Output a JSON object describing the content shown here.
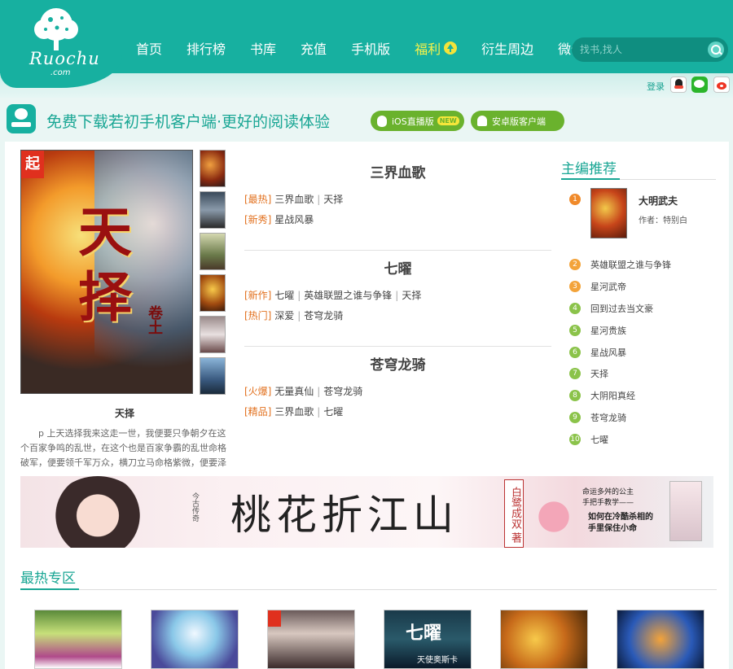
{
  "header": {
    "logo_text": "Ruochu",
    "logo_sub": ".com",
    "nav": [
      {
        "label": "首页"
      },
      {
        "label": "排行榜"
      },
      {
        "label": "书库"
      },
      {
        "label": "充值"
      },
      {
        "label": "手机版"
      },
      {
        "label": "福利"
      },
      {
        "label": "衍生周边"
      },
      {
        "label": "微信"
      }
    ],
    "search_placeholder": "找书,找人"
  },
  "subbar": {
    "login": "登录"
  },
  "promo": {
    "text": "免费下载若初手机客户端·更好的阅读体验",
    "ios_label": "iOS直播版",
    "ios_badge": "NEW",
    "android_label": "安卓版客户端"
  },
  "featured": {
    "cover_mark": "起",
    "cover_title": "天择",
    "cover_subtitle": "卷土",
    "caption": "天择",
    "description": "p 上天选择我来这走一世，我便要只争朝夕在这个百家争鸣的乱世，在这个也是百家争霸的乱世命格破军，便要领千军万众，横刀立马命格紫微，便要泽被苍生"
  },
  "blocks": [
    {
      "title": "三界血歌",
      "rows": [
        {
          "tag": "[最热]",
          "items": [
            "三界血歌",
            "天择"
          ]
        },
        {
          "tag": "[新秀]",
          "items": [
            "星战风暴"
          ]
        }
      ]
    },
    {
      "title": "七曜",
      "rows": [
        {
          "tag": "[新作]",
          "items": [
            "七曜",
            "英雄联盟之谁与争锋",
            "天择"
          ]
        },
        {
          "tag": "[热门]",
          "items": [
            "深爱",
            "苍穹龙骑"
          ]
        }
      ]
    },
    {
      "title": "苍穹龙骑",
      "rows": [
        {
          "tag": "[火爆]",
          "items": [
            "无量真仙",
            "苍穹龙骑"
          ]
        },
        {
          "tag": "[精品]",
          "items": [
            "三界血歌",
            "七曜"
          ]
        }
      ]
    }
  ],
  "recommend": {
    "title": "主编推荐",
    "top": {
      "rank": "1",
      "title": "大明武夫",
      "author": "作者：特别白"
    },
    "list": [
      {
        "rank": "2",
        "title": "英雄联盟之谁与争锋"
      },
      {
        "rank": "3",
        "title": "星河武帝"
      },
      {
        "rank": "4",
        "title": "回到过去当文豪"
      },
      {
        "rank": "5",
        "title": "星河贵族"
      },
      {
        "rank": "6",
        "title": "星战风暴"
      },
      {
        "rank": "7",
        "title": "天择"
      },
      {
        "rank": "8",
        "title": "大阴阳真经"
      },
      {
        "rank": "9",
        "title": "苍穹龙骑"
      },
      {
        "rank": "10",
        "title": "七曜"
      }
    ]
  },
  "ad": {
    "title": "桃花折江山",
    "publisher": "今古传奇",
    "author": "白鹭成双 著",
    "tagline": "命运多舛的公主\n手把手教学——",
    "hook": "如何在冷酷杀相的\n手里保住小命"
  },
  "hot": {
    "title": "最热专区",
    "covers": [
      {
        "text": ""
      },
      {
        "text": ""
      },
      {
        "text": ""
      },
      {
        "text": "七曜",
        "sub": "天使奥斯卡"
      },
      {
        "text": ""
      },
      {
        "text": ""
      }
    ]
  },
  "colors": {
    "brand_teal": "#17b0a0",
    "accent_orange": "#e2711f",
    "green_button": "#6ab22d",
    "rank_orange": "#f08a2a",
    "rank_green": "#8bc34a"
  }
}
